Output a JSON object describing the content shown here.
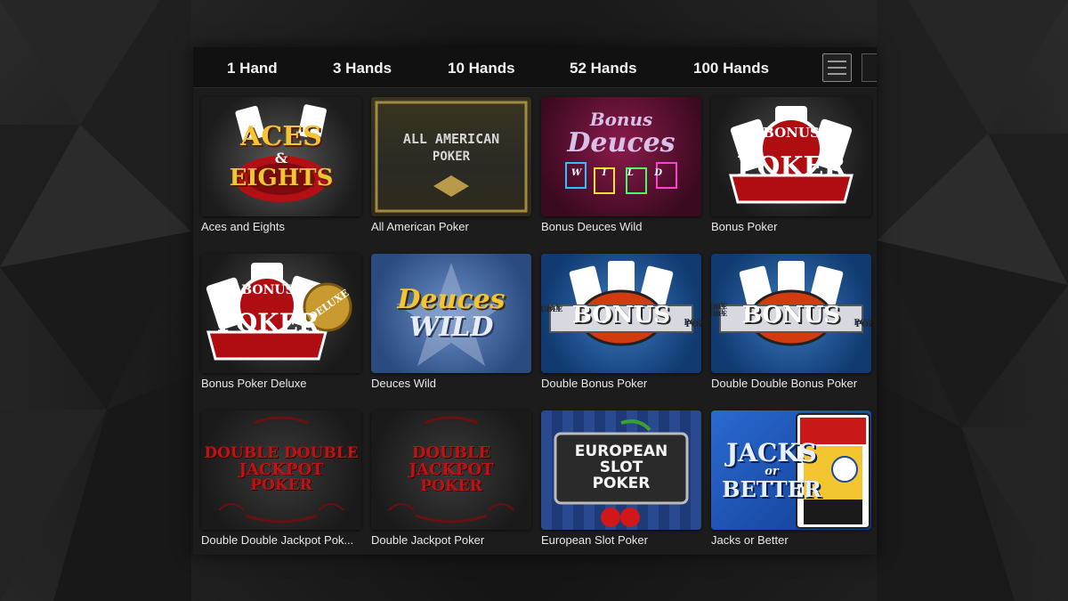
{
  "tabs": [
    "1 Hand",
    "3 Hands",
    "10 Hands",
    "52 Hands",
    "100 Hands"
  ],
  "view_toggle": {
    "list_icon": "list-view-icon",
    "grid_icon": "grid-view-icon"
  },
  "games": [
    {
      "title": "Aces and Eights",
      "art_lines": [
        "ACES",
        "&",
        "EIGHTS"
      ]
    },
    {
      "title": "All American Poker",
      "art_lines": [
        "ALL AMERICAN",
        "POKER"
      ]
    },
    {
      "title": "Bonus Deuces Wild",
      "art_lines": [
        "Bonus",
        "Deuces",
        "W I L D"
      ]
    },
    {
      "title": "Bonus Poker",
      "art_lines": [
        "BONUS",
        "POKER"
      ]
    },
    {
      "title": "Bonus Poker Deluxe",
      "art_lines": [
        "BONUS",
        "POKER",
        "DELUXE"
      ]
    },
    {
      "title": "Deuces Wild",
      "art_lines": [
        "Deuces",
        "WILD"
      ]
    },
    {
      "title": "Double Bonus Poker",
      "art_lines": [
        "DOUBLE",
        "BONUS",
        "POKER"
      ]
    },
    {
      "title": "Double Double Bonus Poker",
      "art_lines": [
        "DOUBLE DOUBLE",
        "BONUS",
        "POKER"
      ]
    },
    {
      "title": "Double Double Jackpot Pok...",
      "art_lines": [
        "DOUBLE DOUBLE",
        "JACKPOT",
        "POKER"
      ]
    },
    {
      "title": "Double Jackpot Poker",
      "art_lines": [
        "DOUBLE",
        "JACKPOT",
        "POKER"
      ]
    },
    {
      "title": "European Slot Poker",
      "art_lines": [
        "EUROPEAN",
        "SLOT",
        "POKER"
      ]
    },
    {
      "title": "Jacks or Better",
      "art_lines": [
        "JACKS",
        "or",
        "BETTER"
      ]
    }
  ]
}
